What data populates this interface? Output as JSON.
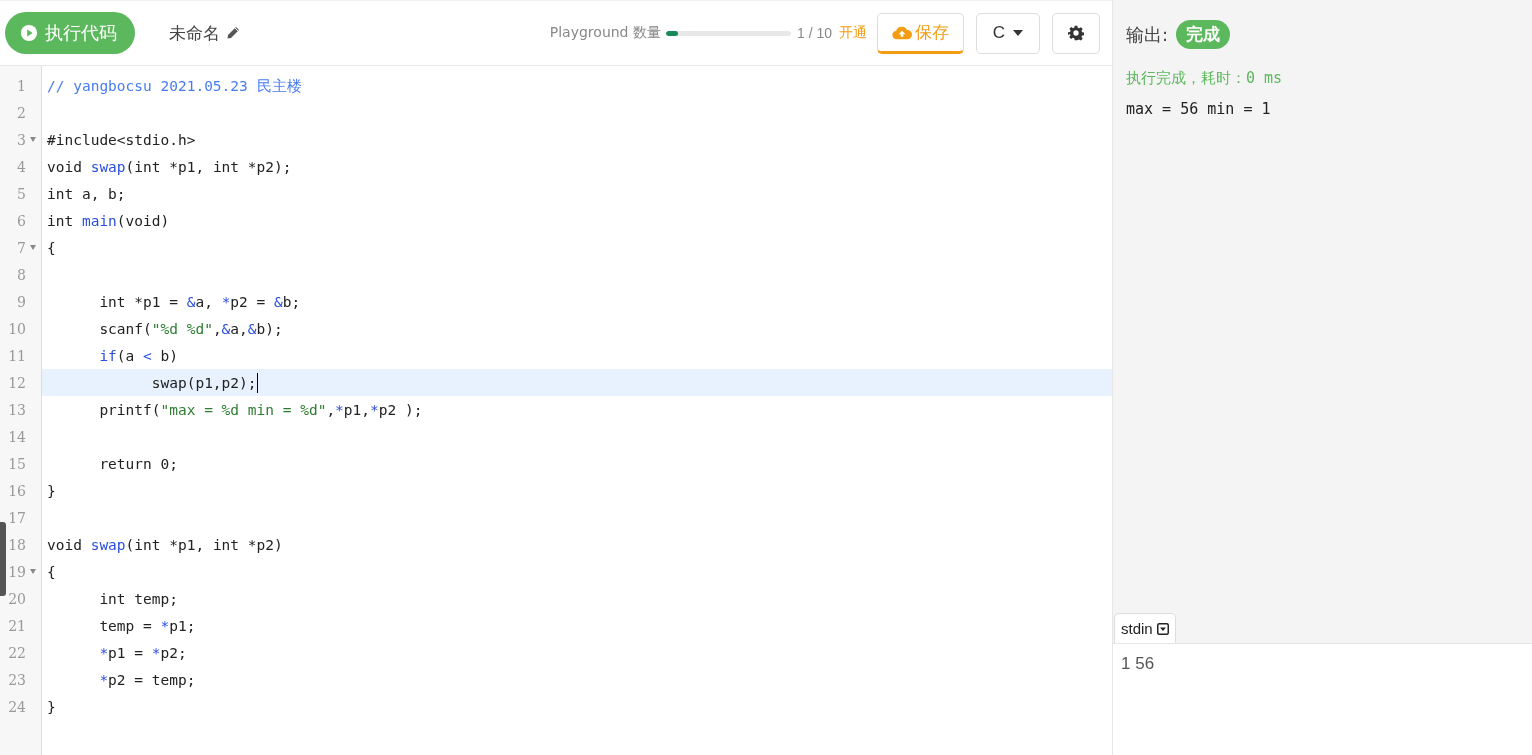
{
  "toolbar": {
    "run_button": "执行代码",
    "file_name": "未命名",
    "quota_label": "Playground 数量",
    "quota": {
      "level": 0.1
    },
    "quota_count": "1 / 10",
    "upgrade_link": "开通",
    "save_button": "保存",
    "language_select": "C"
  },
  "editor": {
    "lines": [
      {
        "number": "1",
        "foldable": false,
        "active": false,
        "tokens": [
          {
            "text": "// yangbocsu 2021.05.23 民主楼",
            "kind": "comment"
          }
        ]
      },
      {
        "number": "2",
        "foldable": false,
        "active": false
      },
      {
        "number": "3",
        "foldable": true,
        "active": false,
        "tokens": [
          {
            "text": "#include<stdio.h>",
            "kind": "plain"
          }
        ]
      },
      {
        "number": "4",
        "foldable": false,
        "active": false,
        "tokens": [
          {
            "text": "void ",
            "kind": "plain"
          },
          {
            "text": "swap",
            "kind": "fn"
          },
          {
            "text": "(int *p1, int *p2);",
            "kind": "plain"
          }
        ]
      },
      {
        "number": "5",
        "foldable": false,
        "active": false,
        "tokens": [
          {
            "text": "int a, b;",
            "kind": "plain"
          }
        ]
      },
      {
        "number": "6",
        "foldable": false,
        "active": false,
        "tokens": [
          {
            "text": "int ",
            "kind": "plain"
          },
          {
            "text": "main",
            "kind": "fn"
          },
          {
            "text": "(void)",
            "kind": "plain"
          }
        ]
      },
      {
        "number": "7",
        "foldable": true,
        "active": false,
        "tokens": [
          {
            "text": "{",
            "kind": "plain"
          }
        ]
      },
      {
        "number": "8",
        "foldable": false,
        "active": false
      },
      {
        "number": "9",
        "foldable": false,
        "active": false,
        "tokens": [
          {
            "text": "      int *p1 = ",
            "kind": "plain"
          },
          {
            "text": "&",
            "kind": "op"
          },
          {
            "text": "a, ",
            "kind": "plain"
          },
          {
            "text": "*",
            "kind": "op"
          },
          {
            "text": "p2 = ",
            "kind": "plain"
          },
          {
            "text": "&",
            "kind": "op"
          },
          {
            "text": "b;",
            "kind": "plain"
          }
        ]
      },
      {
        "number": "10",
        "foldable": false,
        "active": false,
        "tokens": [
          {
            "text": "      scanf(",
            "kind": "plain"
          },
          {
            "text": "\"%d %d\"",
            "kind": "str"
          },
          {
            "text": ",",
            "kind": "plain"
          },
          {
            "text": "&",
            "kind": "op"
          },
          {
            "text": "a,",
            "kind": "plain"
          },
          {
            "text": "&",
            "kind": "op"
          },
          {
            "text": "b);",
            "kind": "plain"
          }
        ]
      },
      {
        "number": "11",
        "foldable": false,
        "active": false,
        "tokens": [
          {
            "text": "      if",
            "kind": "fn"
          },
          {
            "text": "(a ",
            "kind": "plain"
          },
          {
            "text": "<",
            "kind": "op"
          },
          {
            "text": " b)",
            "kind": "plain"
          }
        ]
      },
      {
        "number": "12",
        "foldable": false,
        "active": true,
        "tokens": [
          {
            "text": "            swap(p1,p2);",
            "kind": "plain"
          }
        ]
      },
      {
        "number": "13",
        "foldable": false,
        "active": false,
        "tokens": [
          {
            "text": "      printf(",
            "kind": "plain"
          },
          {
            "text": "\"max = %d min = %d\"",
            "kind": "str"
          },
          {
            "text": ",",
            "kind": "plain"
          },
          {
            "text": "*",
            "kind": "op"
          },
          {
            "text": "p1,",
            "kind": "plain"
          },
          {
            "text": "*",
            "kind": "op"
          },
          {
            "text": "p2 );",
            "kind": "plain"
          }
        ]
      },
      {
        "number": "14",
        "foldable": false,
        "active": false
      },
      {
        "number": "15",
        "foldable": false,
        "active": false,
        "tokens": [
          {
            "text": "      return 0;",
            "kind": "plain"
          }
        ]
      },
      {
        "number": "16",
        "foldable": false,
        "active": false,
        "tokens": [
          {
            "text": "}",
            "kind": "plain"
          }
        ]
      },
      {
        "number": "17",
        "foldable": false,
        "active": false
      },
      {
        "number": "18",
        "foldable": false,
        "active": false,
        "tokens": [
          {
            "text": "void ",
            "kind": "plain"
          },
          {
            "text": "swap",
            "kind": "fn"
          },
          {
            "text": "(int *p1, int *p2)",
            "kind": "plain"
          }
        ]
      },
      {
        "number": "19",
        "foldable": true,
        "active": false,
        "tokens": [
          {
            "text": "{",
            "kind": "plain"
          }
        ]
      },
      {
        "number": "20",
        "foldable": false,
        "active": false,
        "tokens": [
          {
            "text": "      int temp;",
            "kind": "plain"
          }
        ]
      },
      {
        "number": "21",
        "foldable": false,
        "active": false,
        "tokens": [
          {
            "text": "      temp = ",
            "kind": "plain"
          },
          {
            "text": "*",
            "kind": "op"
          },
          {
            "text": "p1;",
            "kind": "plain"
          }
        ]
      },
      {
        "number": "22",
        "foldable": false,
        "active": false,
        "tokens": [
          {
            "text": "      *",
            "kind": "op"
          },
          {
            "text": "p1 = ",
            "kind": "plain"
          },
          {
            "text": "*",
            "kind": "op"
          },
          {
            "text": "p2;",
            "kind": "plain"
          }
        ]
      },
      {
        "number": "23",
        "foldable": false,
        "active": false,
        "tokens": [
          {
            "text": "      *",
            "kind": "op"
          },
          {
            "text": "p2 = temp;",
            "kind": "plain"
          }
        ]
      },
      {
        "number": "24",
        "foldable": false,
        "active": false,
        "tokens": [
          {
            "text": "}",
            "kind": "plain"
          }
        ]
      }
    ]
  },
  "output": {
    "label": "输出:",
    "status": "完成",
    "status_message": "执行完成，耗时：0 ms",
    "result": "max = 56 min = 1"
  },
  "stdin": {
    "tab": "stdin",
    "value": "1 56"
  }
}
